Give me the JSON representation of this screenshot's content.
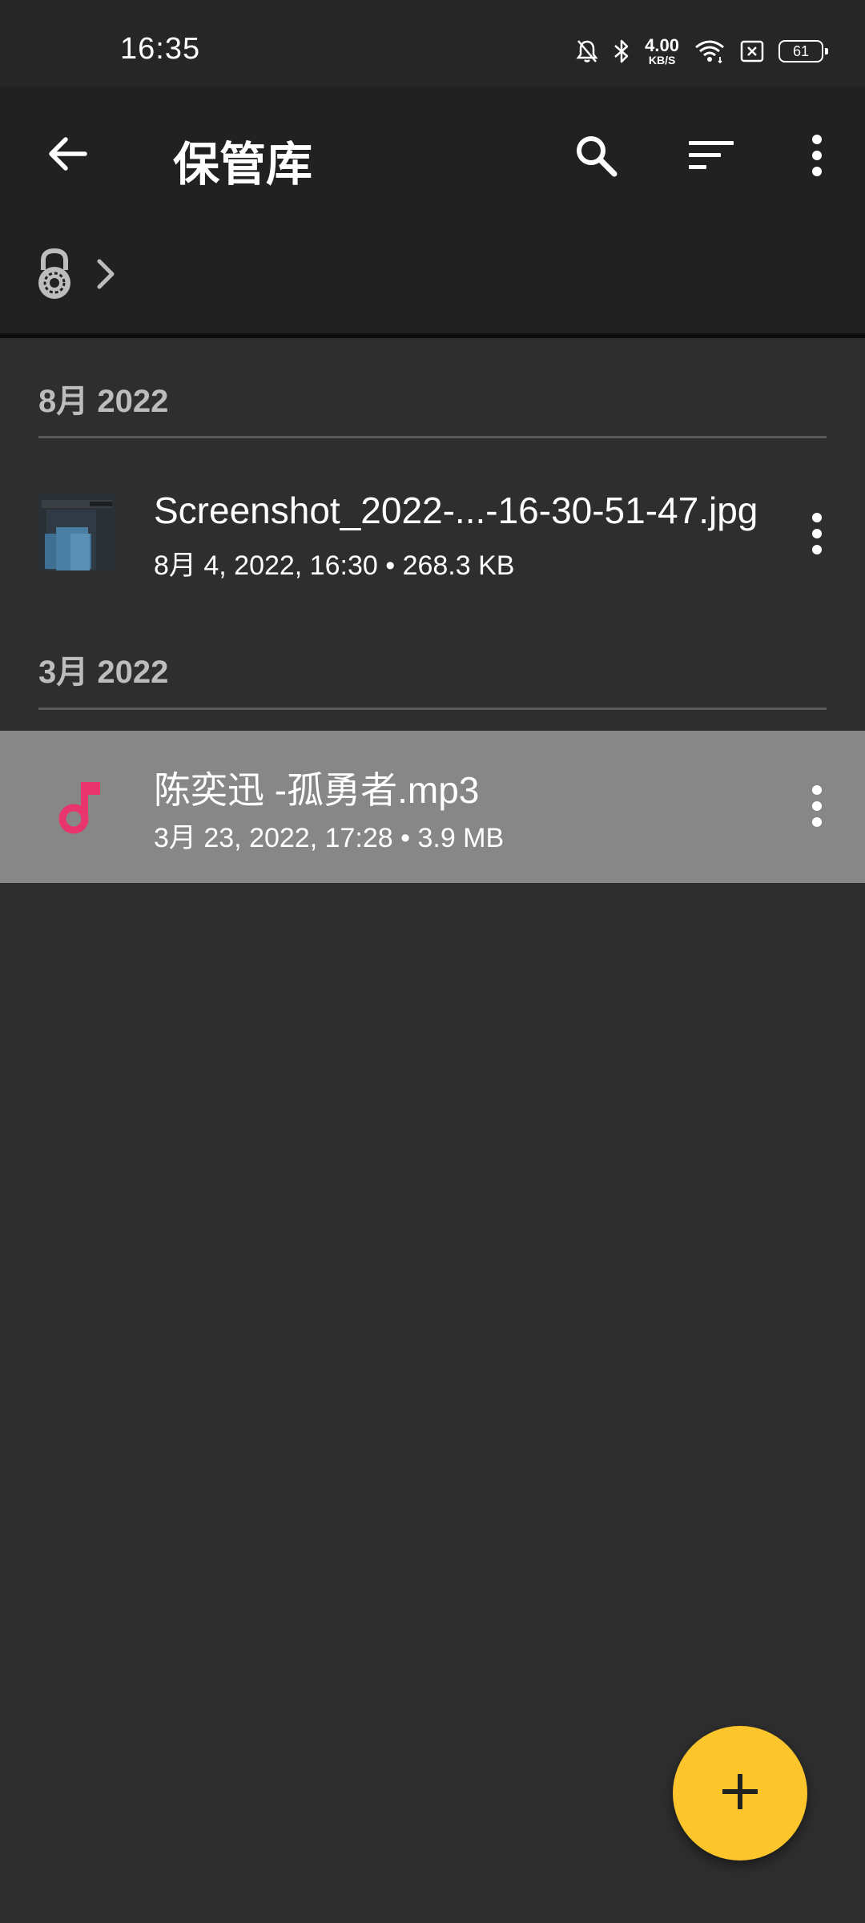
{
  "status_bar": {
    "time": "16:35",
    "net_speed_value": "4.00",
    "net_speed_unit": "KB/S",
    "battery_level": "61",
    "icons": [
      "mute-bell-icon",
      "bluetooth-icon",
      "wifi-icon",
      "sim-off-icon",
      "battery-icon"
    ]
  },
  "app_bar": {
    "title": "保管库",
    "icons": [
      "back-arrow-icon",
      "search-icon",
      "sort-icon",
      "more-vert-icon"
    ]
  },
  "breadcrumb": {
    "icons": [
      "padlock-icon",
      "chevron-right-icon"
    ]
  },
  "sections": [
    {
      "header": "8月 2022",
      "items": [
        {
          "name": "Screenshot_2022-...-16-30-51-47.jpg",
          "meta": "8月 4, 2022, 16:30  •  268.3 KB",
          "thumbnail": "image-thumbnail",
          "selected": false
        }
      ]
    },
    {
      "header": "3月 2022",
      "items": [
        {
          "name": "陈奕迅 -孤勇者.mp3",
          "meta": "3月 23, 2022, 17:28  •  3.9 MB",
          "thumbnail": "music-note-icon",
          "selected": true
        }
      ]
    }
  ],
  "fab": {
    "icon": "plus-icon"
  },
  "colors": {
    "background": "#2e2e2e",
    "app_bar": "#212121",
    "selected_row": "#878787",
    "fab": "#fbc52b",
    "music_icon": "#e8356e",
    "section_header": "#bdbdbd"
  }
}
